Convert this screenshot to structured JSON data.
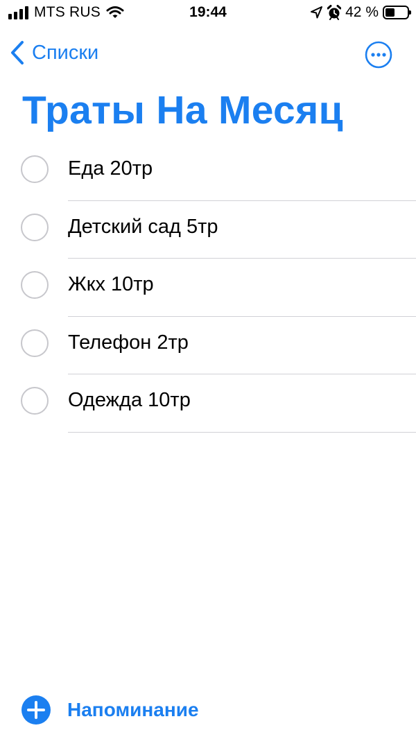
{
  "status_bar": {
    "carrier": "MTS RUS",
    "time": "19:44",
    "battery_percent": "42 %",
    "battery_level": 0.42,
    "signal_bars": 4,
    "icons": [
      "signal-icon",
      "wifi-icon",
      "location-arrow-icon",
      "alarm-clock-icon",
      "battery-icon"
    ]
  },
  "nav": {
    "back_label": "Списки",
    "more_icon": "ellipsis-circle-icon"
  },
  "list": {
    "title": "Траты На Месяц",
    "items": [
      {
        "label": "Еда 20тр"
      },
      {
        "label": "Детский сад 5тр"
      },
      {
        "label": "Жкх 10тр"
      },
      {
        "label": "Телефон 2тр"
      },
      {
        "label": "Одежда 10тр"
      }
    ]
  },
  "footer": {
    "add_label": "Напоминание",
    "add_icon": "plus-circle-icon"
  },
  "colors": {
    "accent": "#1b7ff0",
    "circle_border": "#c7c7cc",
    "divider": "#d1d1d6",
    "background": "#ffffff"
  }
}
